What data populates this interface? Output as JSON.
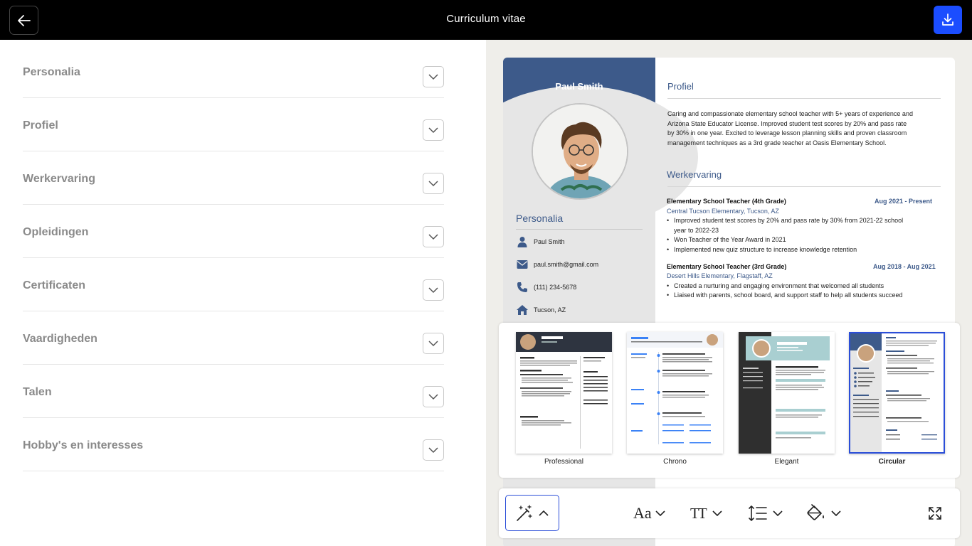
{
  "header": {
    "title": "Curriculum vitae",
    "back_icon": "arrow-left-icon",
    "download_icon": "download-icon",
    "accent": "#1b4dff"
  },
  "sections": [
    {
      "label": "Personalia"
    },
    {
      "label": "Profiel"
    },
    {
      "label": "Werkervaring"
    },
    {
      "label": "Opleidingen"
    },
    {
      "label": "Certificaten"
    },
    {
      "label": "Vaardigheden"
    },
    {
      "label": "Talen"
    },
    {
      "label": "Hobby's en interesses"
    }
  ],
  "cv": {
    "name": "Paul Smith",
    "accent": "#3d5a8a",
    "personalia": {
      "title": "Personalia",
      "items": [
        {
          "icon": "person-icon",
          "text": "Paul Smith"
        },
        {
          "icon": "email-icon",
          "text": "paul.smith@gmail.com"
        },
        {
          "icon": "phone-icon",
          "text": "(111) 234-5678"
        },
        {
          "icon": "home-icon",
          "text": "Tucson, AZ"
        }
      ]
    },
    "profile": {
      "title": "Profiel",
      "text": "Caring and compassionate elementary school teacher with 5+ years of experience and Arizona State Educator License. Improved student test scores by 20% and pass rate by 30% in one year. Excited to leverage lesson planning skills and proven classroom management techniques as a 3rd grade teacher at Oasis Elementary School."
    },
    "experience": {
      "title": "Werkervaring",
      "jobs": [
        {
          "title": "Elementary School Teacher (4th Grade)",
          "date": "Aug 2021 - Present",
          "company": "Central Tucson Elementary, Tucson, AZ",
          "bullets": [
            "Improved student test scores by 20% and pass rate by 30% from 2021-22 school year to 2022-23",
            "Won Teacher of the Year Award in 2021",
            "Implemented new quiz structure to increase knowledge retention"
          ]
        },
        {
          "title": "Elementary School Teacher (3rd Grade)",
          "date": "Aug 2018 - Aug 2021",
          "company": "Desert Hills Elementary, Flagstaff, AZ",
          "bullets": [
            "Created a nurturing and engaging environment that welcomed all students",
            "Liaised with parents, school board, and support staff to help all students succeed"
          ]
        }
      ]
    }
  },
  "templates": [
    {
      "label": "Professional",
      "selected": false
    },
    {
      "label": "Chrono",
      "selected": false
    },
    {
      "label": "Elegant",
      "selected": false
    },
    {
      "label": "Circular",
      "selected": true
    }
  ],
  "toolbar": {
    "magic_icon": "magic-wand-icon",
    "font_label": "Aa",
    "size_label": "TT",
    "spacing_icon": "line-spacing-icon",
    "color_icon": "paint-bucket-icon",
    "expand_icon": "expand-icon"
  }
}
